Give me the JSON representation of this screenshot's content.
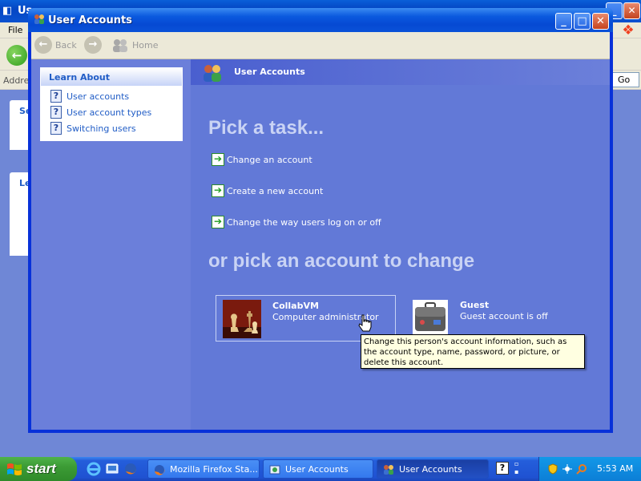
{
  "background_window": {
    "title": "Us",
    "menu_file": "File",
    "address_label": "Addres",
    "go_label": "Go",
    "panel1_heading": "Se",
    "panel2_heading": "Le"
  },
  "window": {
    "title": "User Accounts",
    "buttons": {
      "minimize": "_",
      "maximize": "□",
      "close": "✕"
    }
  },
  "navbar": {
    "back_label": "Back",
    "forward_glyph": "→",
    "back_glyph": "←",
    "home_label": "Home"
  },
  "sidebar": {
    "learn_about": {
      "heading": "Learn About",
      "items": [
        {
          "label": "User accounts",
          "icon": "help-icon"
        },
        {
          "label": "User account types",
          "icon": "help-icon"
        },
        {
          "label": "Switching users",
          "icon": "help-icon"
        }
      ]
    }
  },
  "content": {
    "header_title": "User Accounts",
    "pick_task_heading": "Pick a task...",
    "tasks": [
      {
        "label": "Change an account",
        "icon": "green-arrow-icon"
      },
      {
        "label": "Create a new account",
        "icon": "green-arrow-icon"
      },
      {
        "label": "Change the way users log on or off",
        "icon": "green-arrow-icon"
      }
    ],
    "pick_account_heading": "or pick an account to change",
    "accounts": [
      {
        "name": "CollabVM",
        "detail": "Computer administrator",
        "picture": "chess-pieces-picture"
      },
      {
        "name": "Guest",
        "detail": "Guest account is off",
        "picture": "briefcase-picture"
      }
    ],
    "tooltip": "Change this person's account information, such as the account type, name, password, or picture, or delete this account."
  },
  "taskbar": {
    "start_label": "start",
    "buttons": [
      {
        "label": "Mozilla Firefox Sta...",
        "icon": "firefox-icon",
        "active": false
      },
      {
        "label": "User Accounts",
        "icon": "control-panel-icon",
        "active": false
      },
      {
        "label": "User Accounts",
        "icon": "user-accounts-icon",
        "active": true
      }
    ],
    "help_glyph": "?",
    "clock": "5:53 AM"
  },
  "colors": {
    "title_blue": "#0a59de",
    "content_blue": "#6279d7",
    "link_blue": "#215dc6",
    "start_green": "#3c9b35",
    "tooltip_bg": "#ffffe1"
  }
}
